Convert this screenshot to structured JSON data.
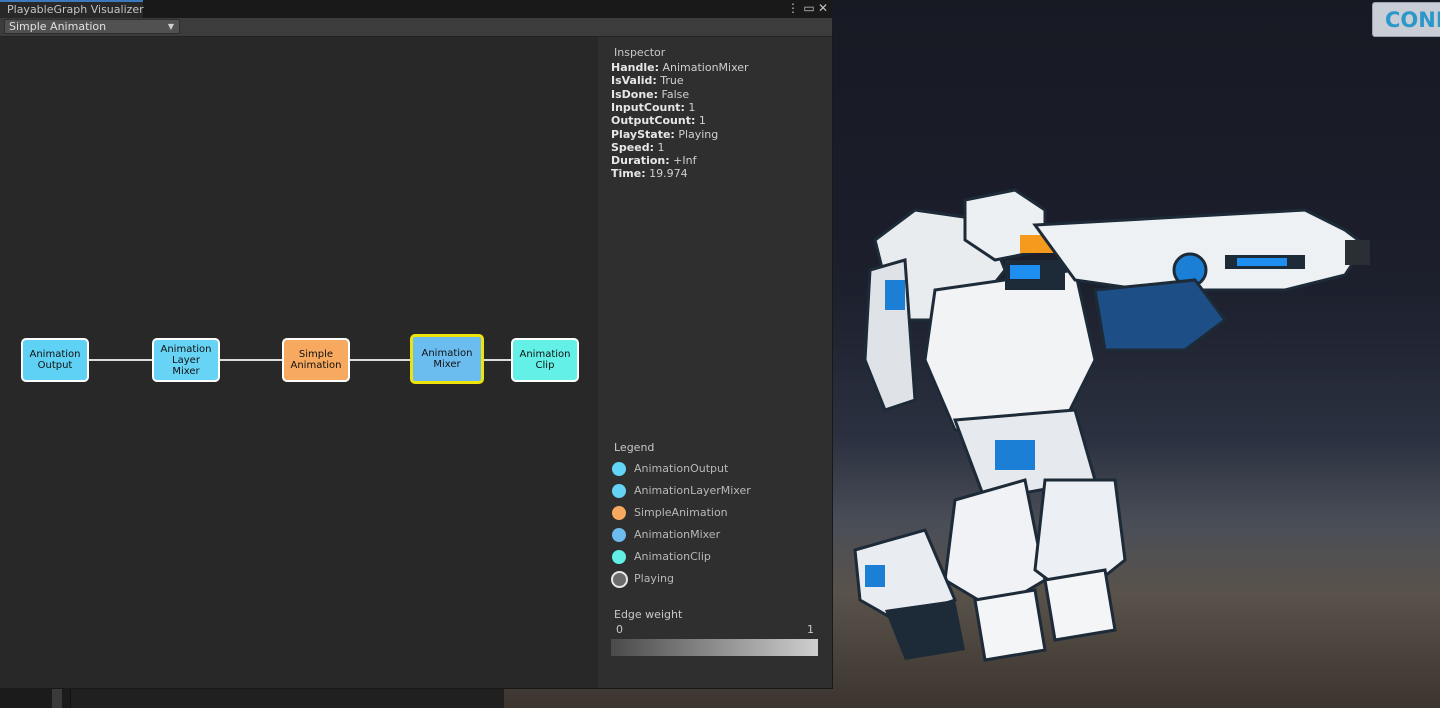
{
  "window": {
    "tab_title": "PlayableGraph Visualizer",
    "menu_icon": "kebab-menu-icon",
    "maximize_icon": "maximize-icon",
    "close_icon": "close-icon"
  },
  "toolbar": {
    "graph_select_value": "Simple Animation"
  },
  "graph": {
    "nodes": [
      {
        "id": "animation-output",
        "label": "Animation\nOutput",
        "color": "#5fd1f4"
      },
      {
        "id": "animation-layer-mixer",
        "label": "Animation\nLayer\nMixer",
        "color": "#67d3f5"
      },
      {
        "id": "simple-animation",
        "label": "Simple\nAnimation",
        "color": "#f7a95f"
      },
      {
        "id": "animation-mixer",
        "label": "Animation\nMixer",
        "color": "#6bbcef",
        "selected": true
      },
      {
        "id": "animation-clip",
        "label": "Animation\nClip",
        "color": "#63f1e7"
      }
    ],
    "edge_color": "#dcdcdc"
  },
  "inspector": {
    "title": "Inspector",
    "rows": [
      {
        "key": "Handle:",
        "value": "AnimationMixer"
      },
      {
        "key": "IsValid:",
        "value": "True"
      },
      {
        "key": "IsDone:",
        "value": "False"
      },
      {
        "key": "InputCount:",
        "value": "1"
      },
      {
        "key": "OutputCount:",
        "value": "1"
      },
      {
        "key": "PlayState:",
        "value": "Playing"
      },
      {
        "key": "Speed:",
        "value": "1"
      },
      {
        "key": "Duration:",
        "value": "+Inf"
      },
      {
        "key": "Time:",
        "value": "19.974"
      }
    ]
  },
  "legend": {
    "title": "Legend",
    "items": [
      {
        "label": "AnimationOutput",
        "color": "#62d4f5"
      },
      {
        "label": "AnimationLayerMixer",
        "color": "#66d3f5"
      },
      {
        "label": "SimpleAnimation",
        "color": "#f6a95f"
      },
      {
        "label": "AnimationMixer",
        "color": "#6cbcef"
      },
      {
        "label": "AnimationClip",
        "color": "#62efe6"
      },
      {
        "label": "Playing",
        "color": "#6b6b6b",
        "ring": true
      }
    ]
  },
  "edge_weight": {
    "title": "Edge weight",
    "min_label": "0",
    "max_label": "1"
  },
  "scene": {
    "connect_button_label": "CONN"
  }
}
